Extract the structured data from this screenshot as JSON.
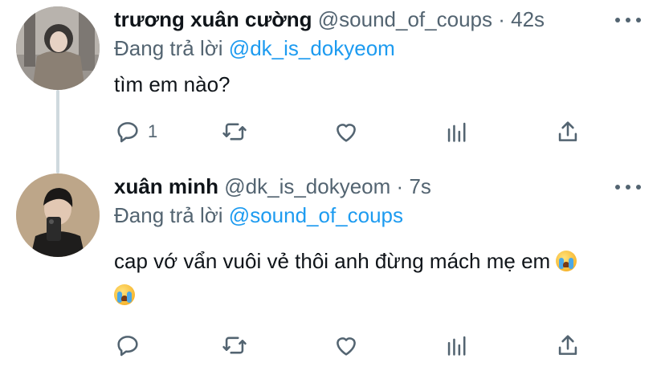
{
  "tweets": [
    {
      "display_name": "trương xuân cường",
      "handle": "@sound_of_coups",
      "separator": "·",
      "time": "42s",
      "reply_prefix": "Đang trả lời",
      "reply_to": "@dk_is_dokyeom",
      "text": "tìm em nào?",
      "reply_count": "1",
      "avatar_icon": "user-photo-avatar"
    },
    {
      "display_name": "xuân minh",
      "handle": "@dk_is_dokyeom",
      "separator": "·",
      "time": "7s",
      "reply_prefix": "Đang trả lời",
      "reply_to": "@sound_of_coups",
      "text": "cap vớ vẩn vuôi vẻ thôi anh đừng mách mẹ em",
      "emoji_icon": "loudly-crying-face-emoji",
      "reply_count": "",
      "avatar_icon": "user-photo-avatar"
    }
  ],
  "icons": {
    "reply": "reply-icon",
    "retweet": "retweet-icon",
    "like": "heart-icon",
    "analytics": "analytics-icon",
    "share": "share-icon",
    "more": "more-icon"
  },
  "colors": {
    "text": "#0f1419",
    "muted": "#536471",
    "link": "#1d9bf0",
    "thread_line": "#cfd9de"
  }
}
